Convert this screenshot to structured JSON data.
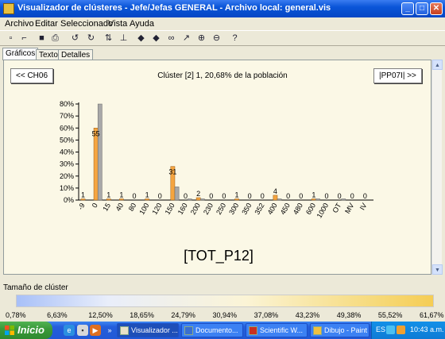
{
  "window": {
    "title": "Visualizador de clústeres - Jefe/Jefas GENERAL - Archivo local: general.vis",
    "controls": {
      "minimize": "_",
      "maximize": "□",
      "close": "✕"
    }
  },
  "menu": [
    "Archivo",
    "Editar",
    "Seleccionado",
    "Vista",
    "Ayuda"
  ],
  "toolbar": [
    "new-icon",
    "open-icon",
    "save-icon",
    "print-icon",
    "undo-icon",
    "redo-icon",
    "sort-icon",
    "filter-icon",
    "back-icon",
    "forward-icon",
    "binoculars-icon",
    "pointer-icon",
    "zoom-in-icon",
    "zoom-out-icon",
    "help-icon"
  ],
  "tabs": [
    "Gráficos",
    "Texto",
    "Detalles"
  ],
  "nav": {
    "prev": "<< CH06",
    "next": "|PP07I| >>"
  },
  "cluster_title": "Clúster [2] 1, 20,68% de la población",
  "chart_data": {
    "type": "bar",
    "categories": [
      "-9",
      "0",
      "15",
      "40",
      "80",
      "100",
      "120",
      "150",
      "160",
      "200",
      "230",
      "250",
      "300",
      "350",
      "352",
      "400",
      "450",
      "480",
      "600",
      "1000",
      "OT",
      "MV",
      "IV"
    ],
    "series": [
      {
        "values": [
          1,
          60,
          1,
          1,
          0,
          1,
          0,
          28,
          0,
          2,
          0,
          0,
          1,
          0,
          0,
          4,
          0,
          0,
          1,
          0,
          0,
          0,
          0
        ]
      },
      {
        "values": [
          0,
          80,
          0,
          0,
          0,
          0,
          0,
          11,
          1,
          1,
          0,
          0,
          0,
          0,
          0,
          1,
          0,
          0,
          1,
          0,
          1,
          0,
          0
        ]
      }
    ],
    "data_labels": [
      "1",
      "55",
      "1",
      "1",
      "0",
      "1",
      "0",
      "31",
      "0",
      "2",
      "0",
      "0",
      "1",
      "0",
      "0",
      "4",
      "0",
      "0",
      "1",
      "0",
      "0",
      "0",
      "0"
    ],
    "yticks": [
      "0%",
      "10%",
      "20%",
      "30%",
      "40%",
      "50%",
      "60%",
      "70%",
      "80%"
    ],
    "ylim": [
      0,
      80
    ],
    "colors": {
      "cluster": "#f5a540",
      "population": "#a8a8a8"
    },
    "caption": "[TOT_P12]"
  },
  "cluster_size": {
    "label": "Tamaño de clúster",
    "ticks": [
      "0,78%",
      "6,63%",
      "12,50%",
      "18,65%",
      "24,79%",
      "30,94%",
      "37,08%",
      "43,23%",
      "49,38%",
      "55,52%",
      "61,67%"
    ]
  },
  "taskbar": {
    "start": "Inicio",
    "quicklaunch_more": "»",
    "tasks": [
      "Visualizador ...",
      "Documento...",
      "Scientific W...",
      "Dibujo - Paint"
    ],
    "lang": "ES",
    "clock": "10:43 a.m."
  }
}
